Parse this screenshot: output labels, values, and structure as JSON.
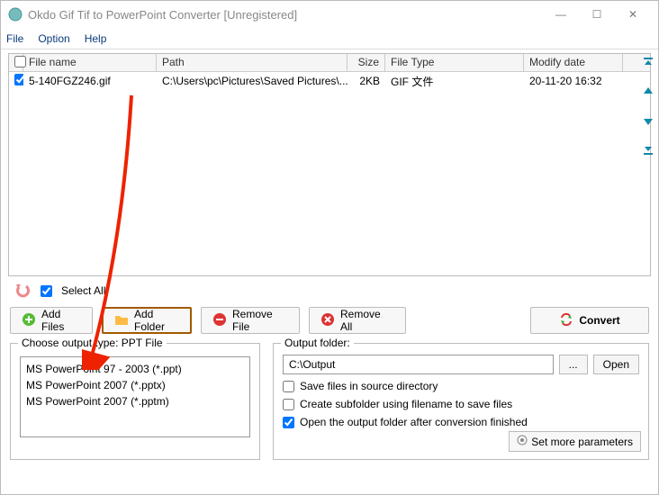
{
  "window": {
    "title": "Okdo Gif Tif to PowerPoint Converter [Unregistered]"
  },
  "menu": {
    "file": "File",
    "option": "Option",
    "help": "Help"
  },
  "table": {
    "headers": {
      "filename": "File name",
      "path": "Path",
      "size": "Size",
      "filetype": "File Type",
      "modify": "Modify date"
    },
    "rows": [
      {
        "checked": true,
        "name": "5-140FGZ246.gif",
        "path": "C:\\Users\\pc\\Pictures\\Saved Pictures\\...",
        "size": "2KB",
        "type": "GIF 文件",
        "date": "20-11-20 16:32"
      }
    ]
  },
  "selectall": "Select All",
  "buttons": {
    "addfiles": "Add Files",
    "addfolder": "Add Folder",
    "removefile": "Remove File",
    "removeall": "Remove All",
    "convert": "Convert"
  },
  "output_type": {
    "label_prefix": "Choose output type:",
    "current": "PPT File",
    "options": [
      "MS PowerPoint 97 - 2003 (*.ppt)",
      "MS PowerPoint 2007 (*.pptx)",
      "MS PowerPoint 2007 (*.pptm)"
    ]
  },
  "output_folder": {
    "label": "Output folder:",
    "path": "C:\\Output",
    "browse": "...",
    "open": "Open",
    "opt_save_src": "Save files in source directory",
    "opt_subfolder": "Create subfolder using filename to save files",
    "opt_openafter": "Open the output folder after conversion finished",
    "more": "Set more parameters"
  }
}
